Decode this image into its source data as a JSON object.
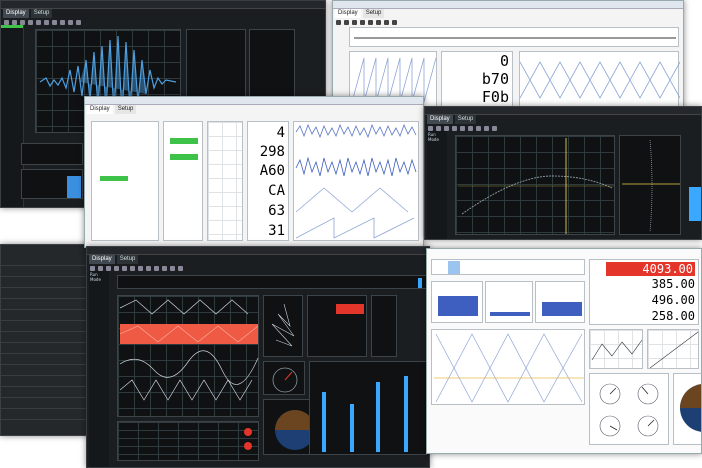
{
  "tabs": {
    "display": "Display",
    "setup": "Setup"
  },
  "mode_label": "Run Mode",
  "window_a": {
    "digits": [
      "0",
      "b70",
      "F0b"
    ]
  },
  "window_b": {
    "digits": [
      "4",
      "298",
      "A60",
      "CA",
      "63",
      "31"
    ]
  },
  "window_d": {
    "digits": [
      "4093.00",
      "385.00",
      "496.00",
      "258.00"
    ]
  },
  "colors": {
    "dark_bg": "#1b1e21",
    "trace_blue": "#4d9fe0",
    "trace_light": "#8fa6d6",
    "highlight_red": "#e3352a",
    "band_red": "#ef5a45",
    "bar_blue": "#3f5fc0",
    "status_green": "#3fc24a",
    "pie_brown": "#6b4520",
    "pie_navy": "#1d3f73",
    "gauge_bar": "#3aa8ff"
  },
  "icons": [
    "toolbar-icons",
    "gauge-icon",
    "pie-chart-icon"
  ]
}
